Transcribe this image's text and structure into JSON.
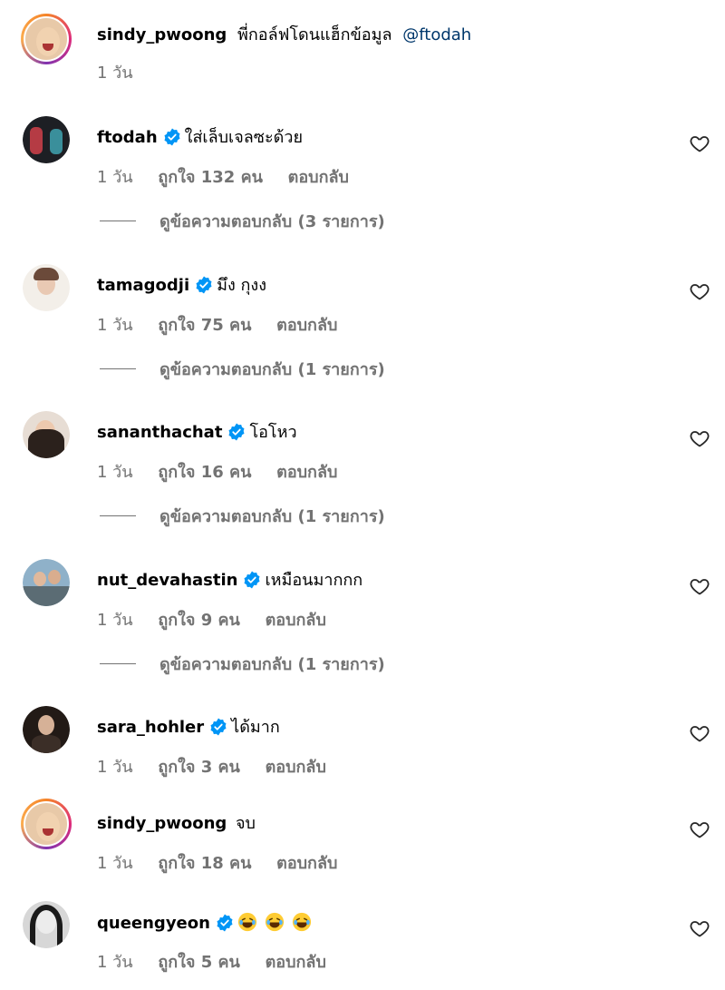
{
  "comments": [
    {
      "username": "sindy_pwoong",
      "verified": false,
      "text": "พี่กอล์ฟโดนแฮ็กข้อมูล",
      "mention": "@ftodah",
      "time": "1 วัน",
      "likes": "",
      "reply": ""
    },
    {
      "username": "ftodah",
      "verified": true,
      "text": "ใส่เล็บเจลซะด้วย",
      "time": "1 วัน",
      "likes": "ถูกใจ 132 คน",
      "reply": "ตอบกลับ",
      "view_replies": "ดูข้อความตอบกลับ (3 รายการ)"
    },
    {
      "username": "tamagodji",
      "verified": true,
      "text": "มึง กุงง",
      "time": "1 วัน",
      "likes": "ถูกใจ 75 คน",
      "reply": "ตอบกลับ",
      "view_replies": "ดูข้อความตอบกลับ (1 รายการ)"
    },
    {
      "username": "sananthachat",
      "verified": true,
      "text": "โอโหว",
      "time": "1 วัน",
      "likes": "ถูกใจ 16 คน",
      "reply": "ตอบกลับ",
      "view_replies": "ดูข้อความตอบกลับ (1 รายการ)"
    },
    {
      "username": "nut_devahastin",
      "verified": true,
      "text": "เหมือนมากกก",
      "time": "1 วัน",
      "likes": "ถูกใจ 9 คน",
      "reply": "ตอบกลับ",
      "view_replies": "ดูข้อความตอบกลับ (1 รายการ)"
    },
    {
      "username": "sara_hohler",
      "verified": true,
      "text": "ได้มาก",
      "time": "1 วัน",
      "likes": "ถูกใจ 3 คน",
      "reply": "ตอบกลับ"
    },
    {
      "username": "sindy_pwoong",
      "verified": false,
      "text": "จบ",
      "time": "1 วัน",
      "likes": "ถูกใจ 18 คน",
      "reply": "ตอบกลับ"
    },
    {
      "username": "queengyeon",
      "verified": true,
      "text": "",
      "emojis": [
        "laughing-emoji",
        "laughing-emoji",
        "laughing-emoji"
      ],
      "time": "1 วัน",
      "likes": "ถูกใจ 5 คน",
      "reply": "ตอบกลับ"
    }
  ],
  "colors": {
    "verified": "#0095f6",
    "mention": "#00376b",
    "secondary": "#737373"
  }
}
